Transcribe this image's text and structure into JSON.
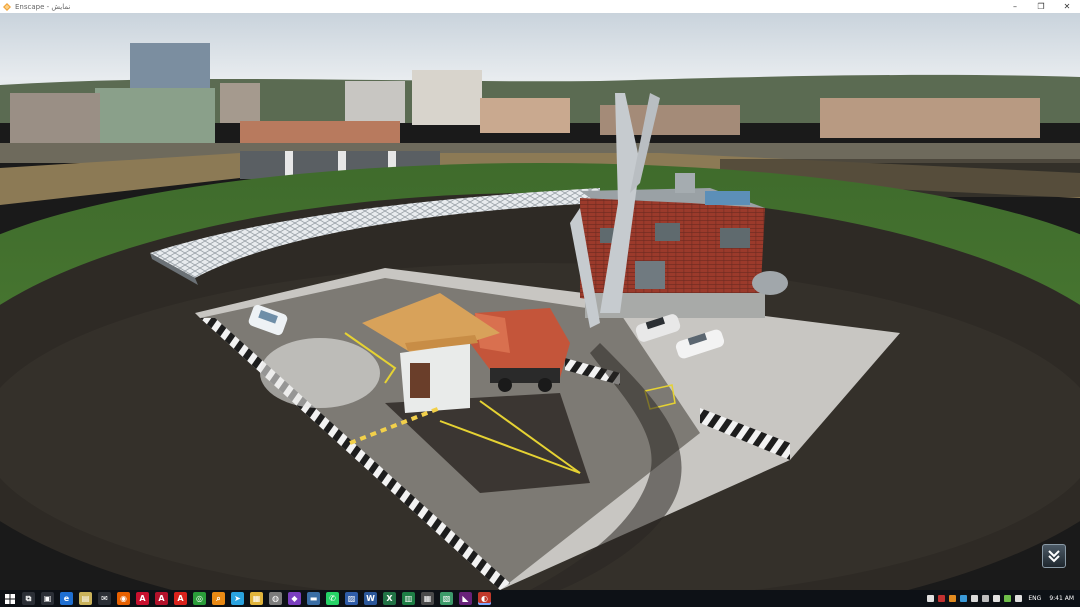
{
  "window": {
    "title": "Enscape - نمایش",
    "minimize_glyph": "–",
    "maximize_glyph": "❐",
    "close_glyph": "✕",
    "app_icon": "enscape-logo-icon"
  },
  "viewport": {
    "scene": "3D rendered gate house, barrier, dump truck, cars, red-brick office with steel canopy and city skyline background",
    "nav_button_icon": "double-chevron-down-icon"
  },
  "taskbar": {
    "start_icon": "windows-start-icon",
    "apps": [
      {
        "name": "task-view-icon",
        "glyph": "⧉",
        "color": "#2b2f36"
      },
      {
        "name": "store-icon",
        "glyph": "▣",
        "color": "#2b2f36"
      },
      {
        "name": "edge-icon",
        "glyph": "e",
        "color": "#1f6fd1"
      },
      {
        "name": "notepad-icon",
        "glyph": "▤",
        "color": "#c9b25a"
      },
      {
        "name": "mail-icon",
        "glyph": "✉",
        "color": "#2b2f36"
      },
      {
        "name": "firefox-icon",
        "glyph": "◉",
        "color": "#e66000"
      },
      {
        "name": "autocad-icon",
        "glyph": "A",
        "color": "#c8102e"
      },
      {
        "name": "revit-icon",
        "glyph": "A",
        "color": "#b3122b"
      },
      {
        "name": "acrobat-icon",
        "glyph": "A",
        "color": "#d9221c"
      },
      {
        "name": "chrome-icon",
        "glyph": "◎",
        "color": "#2a9d3a"
      },
      {
        "name": "search-app-icon",
        "glyph": "⌕",
        "color": "#e98a15"
      },
      {
        "name": "telegram-icon",
        "glyph": "➤",
        "color": "#2aa3e0"
      },
      {
        "name": "files-icon",
        "glyph": "▦",
        "color": "#e0b43c"
      },
      {
        "name": "globe-icon",
        "glyph": "◍",
        "color": "#7c7c7c"
      },
      {
        "name": "media-icon",
        "glyph": "◆",
        "color": "#7b3fbf"
      },
      {
        "name": "video-icon",
        "glyph": "▬",
        "color": "#3a6ea5"
      },
      {
        "name": "whatsapp-icon",
        "glyph": "✆",
        "color": "#25d366"
      },
      {
        "name": "photos-icon",
        "glyph": "▨",
        "color": "#2f5ca8"
      },
      {
        "name": "word-icon",
        "glyph": "W",
        "color": "#2b579a"
      },
      {
        "name": "excel-icon",
        "glyph": "X",
        "color": "#217346"
      },
      {
        "name": "sheets-icon",
        "glyph": "▥",
        "color": "#1e7e45"
      },
      {
        "name": "calculator-icon",
        "glyph": "▦",
        "color": "#4a4a4a"
      },
      {
        "name": "gallery-icon",
        "glyph": "▧",
        "color": "#3d9b6a"
      },
      {
        "name": "visual-studio-icon",
        "glyph": "◣",
        "color": "#68217a"
      },
      {
        "name": "enscape-taskbar-icon",
        "glyph": "◐",
        "color": "#c0392b",
        "active": true
      }
    ],
    "tray_icons": [
      {
        "name": "tray-app1-icon",
        "color": "#e0e0e0"
      },
      {
        "name": "tray-app2-icon",
        "color": "#c03030"
      },
      {
        "name": "tray-app3-icon",
        "color": "#e08a20"
      },
      {
        "name": "tray-app4-icon",
        "color": "#3a9ad9"
      },
      {
        "name": "tray-search-icon",
        "color": "#d9d9d9"
      },
      {
        "name": "tray-network-icon",
        "color": "#bdbdbd"
      },
      {
        "name": "tray-shield-icon",
        "color": "#e0e0e0"
      },
      {
        "name": "tray-battery-icon",
        "color": "#6fbf4a"
      },
      {
        "name": "tray-volume-icon",
        "color": "#e0e0e0"
      }
    ],
    "language": "ENG",
    "time": "9:41 AM"
  }
}
